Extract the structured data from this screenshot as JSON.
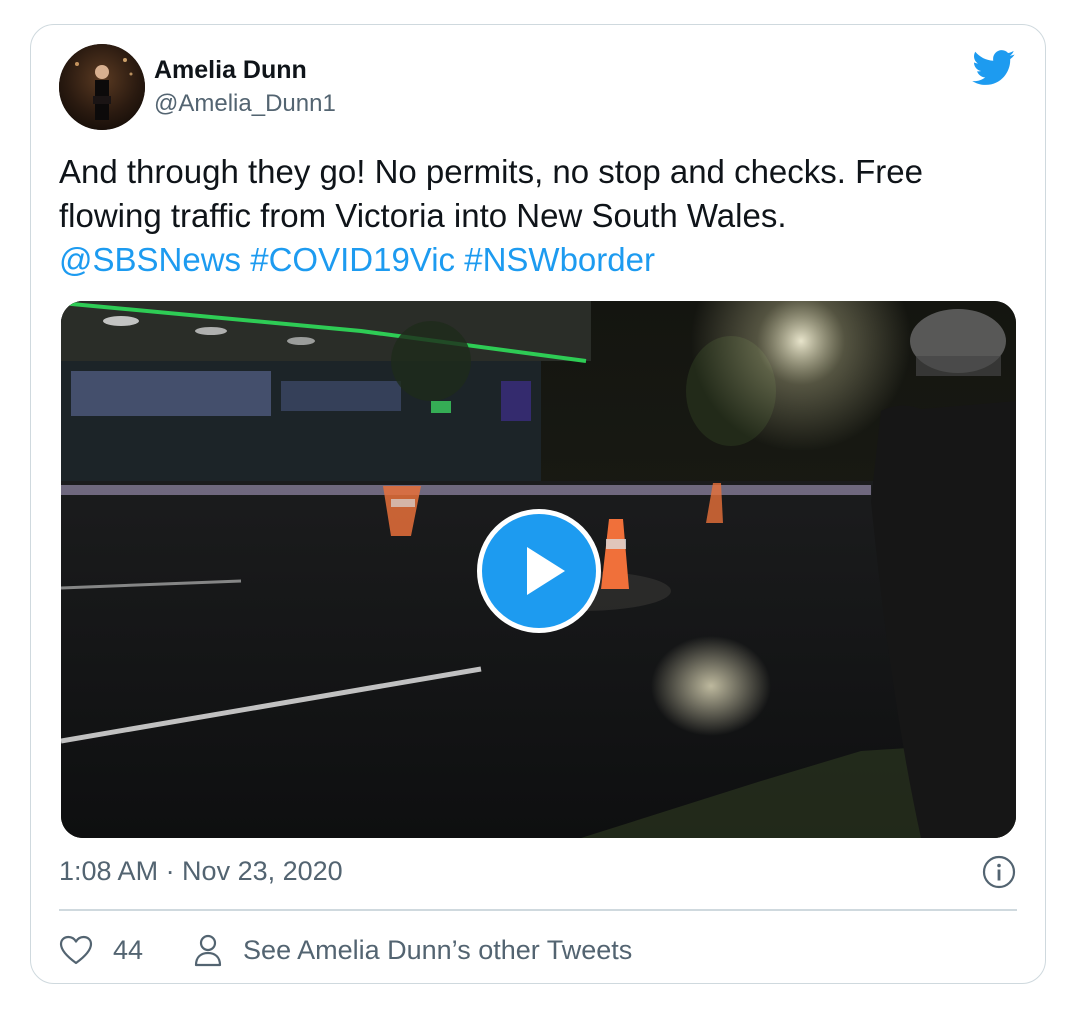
{
  "tweet": {
    "author_name": "Amelia Dunn",
    "author_handle": "@Amelia_Dunn1",
    "text_lines": [
      "And through they go! No permits, no stop and checks. Free",
      "flowing traffic from Victoria into New South Wales."
    ],
    "links": [
      "@SBSNews",
      "#COVID19Vic",
      "#NSWborder"
    ],
    "timestamp": "1:08 AM · Nov 23, 2020",
    "like_count": "44",
    "see_more_label": "See Amelia Dunn’s other Tweets"
  },
  "icons": {
    "brand": "twitter-bird-icon",
    "play": "play-icon",
    "info": "info-icon",
    "like": "heart-icon",
    "profile": "person-icon"
  },
  "colors": {
    "accent": "#1d9bf0",
    "text": "#0f1419",
    "secondary": "#536471",
    "border": "#cfd9de"
  }
}
